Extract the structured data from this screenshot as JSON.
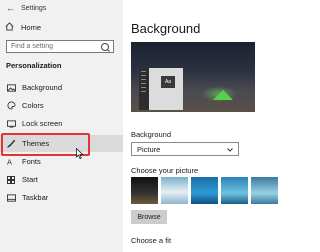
{
  "window": {
    "title": "Settings"
  },
  "sidebar": {
    "home_label": "Home",
    "search_placeholder": "Find a setting",
    "section_title": "Personalization",
    "items": [
      {
        "label": "Background",
        "icon": "picture-icon"
      },
      {
        "label": "Colors",
        "icon": "palette-icon"
      },
      {
        "label": "Lock screen",
        "icon": "monitor-icon"
      },
      {
        "label": "Themes",
        "icon": "brush-icon",
        "active": true
      },
      {
        "label": "Fonts",
        "icon": "font-icon"
      },
      {
        "label": "Start",
        "icon": "start-icon"
      },
      {
        "label": "Taskbar",
        "icon": "taskbar-icon"
      }
    ]
  },
  "main": {
    "page_title": "Background",
    "background_label": "Background",
    "background_value": "Picture",
    "choose_picture_label": "Choose your picture",
    "browse_label": "Browse",
    "choose_fit_label": "Choose a fit",
    "preview_sample_text": "Aa"
  },
  "colors": {
    "highlight": "#e03535",
    "sidebar_bg": "#f1f1f1",
    "accent_tent": "#55d24a"
  }
}
